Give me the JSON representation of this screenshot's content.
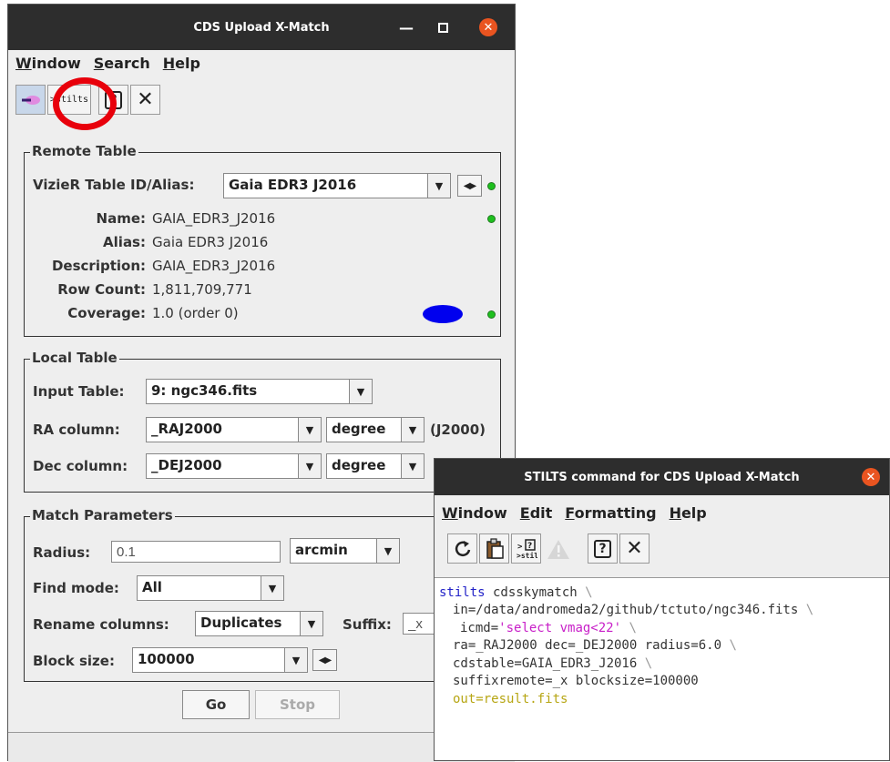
{
  "main_window": {
    "title": "CDS Upload X-Match",
    "menu": [
      "Window",
      "Search",
      "Help"
    ],
    "toolbar": {
      "stilts_icon_text": ">stilts",
      "help_icon_text": "?",
      "close_icon_text": "✕"
    },
    "remote_table": {
      "title": "Remote Table",
      "vizier_label": "VizieR Table ID/Alias:",
      "vizier_value": "Gaia EDR3 J2016",
      "name_label": "Name:",
      "name_value": "GAIA_EDR3_J2016",
      "alias_label": "Alias:",
      "alias_value": "Gaia EDR3 J2016",
      "description_label": "Description:",
      "description_value": "GAIA_EDR3_J2016",
      "rowcount_label": "Row Count:",
      "rowcount_value": "1,811,709,771",
      "coverage_label": "Coverage:",
      "coverage_value": "1.0 (order 0)",
      "coverage_color": "#0000ee"
    },
    "local_table": {
      "title": "Local Table",
      "input_label": "Input Table:",
      "input_value": "9: ngc346.fits",
      "ra_label": "RA column:",
      "ra_value": "_RAJ2000",
      "ra_unit": "degree",
      "ra_system": "(J2000)",
      "dec_label": "Dec column:",
      "dec_value": "_DEJ2000",
      "dec_unit": "degree"
    },
    "match_params": {
      "title": "Match Parameters",
      "radius_label": "Radius:",
      "radius_value": "0.1",
      "radius_unit": "arcmin",
      "find_label": "Find mode:",
      "find_value": "All",
      "rename_label": "Rename columns:",
      "rename_value": "Duplicates",
      "suffix_label": "Suffix:",
      "suffix_value": "_x",
      "block_label": "Block size:",
      "block_value": "100000"
    },
    "buttons": {
      "go": "Go",
      "stop": "Stop"
    }
  },
  "stilts_window": {
    "title": "STILTS command for CDS Upload X-Match",
    "menu": [
      "Window",
      "Edit",
      "Formatting",
      "Help"
    ],
    "code": {
      "line1_cmd": "stilts",
      "line1_task": " cdsskymatch ",
      "line2": "in=/data/andromeda2/github/tctuto/ngc346.fits ",
      "line3_key": "icmd=",
      "line3_val": "'select vmag<22'",
      "line4": "ra=_RAJ2000 dec=_DEJ2000 radius=6.0 ",
      "line5": "cdstable=GAIA_EDR3_J2016 ",
      "line6": "suffixremote=_x blocksize=100000",
      "line7": "out=result.fits",
      "continuation": "\\"
    }
  },
  "annotation": {
    "highlight_color": "#e8000b"
  }
}
